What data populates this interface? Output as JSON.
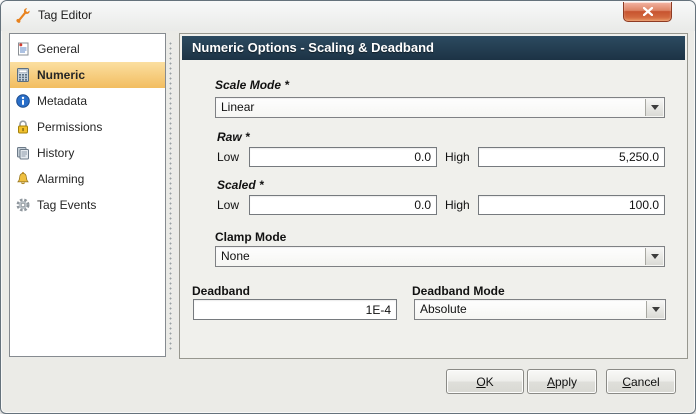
{
  "window": {
    "title": "Tag Editor"
  },
  "sidebar": {
    "items": [
      {
        "label": "General",
        "icon": "general-icon",
        "selected": false
      },
      {
        "label": "Numeric",
        "icon": "numeric-icon",
        "selected": true
      },
      {
        "label": "Metadata",
        "icon": "metadata-icon",
        "selected": false
      },
      {
        "label": "Permissions",
        "icon": "permissions-icon",
        "selected": false
      },
      {
        "label": "History",
        "icon": "history-icon",
        "selected": false
      },
      {
        "label": "Alarming",
        "icon": "alarming-icon",
        "selected": false
      },
      {
        "label": "Tag Events",
        "icon": "tag-events-icon",
        "selected": false
      }
    ]
  },
  "panel": {
    "header": "Numeric Options - Scaling & Deadband",
    "scale_mode": {
      "label": "Scale Mode *",
      "value": "Linear"
    },
    "raw": {
      "label": "Raw *",
      "low_label": "Low",
      "low_value": "0.0",
      "high_label": "High",
      "high_value": "5,250.0"
    },
    "scaled": {
      "label": "Scaled *",
      "low_label": "Low",
      "low_value": "0.0",
      "high_label": "High",
      "high_value": "100.0"
    },
    "clamp_mode": {
      "label": "Clamp Mode",
      "value": "None"
    },
    "deadband": {
      "label": "Deadband",
      "value": "1E-4"
    },
    "deadband_mode": {
      "label": "Deadband Mode",
      "value": "Absolute"
    }
  },
  "footer": {
    "ok_label": "OK",
    "apply_label": "Apply",
    "cancel_label": "Cancel"
  },
  "colors": {
    "header_bg": "#22394b",
    "selection_orange": "#f2bd60",
    "close_red": "#c7532f",
    "panel_bg": "#f0f0ec"
  }
}
